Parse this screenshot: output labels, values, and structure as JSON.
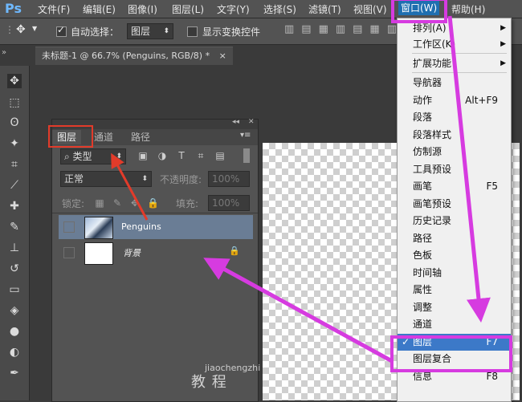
{
  "app": {
    "logo": "Ps"
  },
  "menubar": {
    "items": [
      "文件(F)",
      "编辑(E)",
      "图像(I)",
      "图层(L)",
      "文字(Y)",
      "选择(S)",
      "滤镜(T)",
      "视图(V)",
      "窗口(W)",
      "帮助(H)"
    ],
    "active": "窗口(W)"
  },
  "options": {
    "auto_select_label": "自动选择：",
    "auto_select_checked": true,
    "auto_select_target": "图层",
    "show_transform_label": "显示变换控件",
    "show_transform_checked": false
  },
  "document": {
    "tab_title": "未标题-1 @ 66.7% (Penguins, RGB/8) *",
    "close": "×"
  },
  "layers_panel": {
    "tabs": [
      "图层",
      "通道",
      "路径"
    ],
    "active_tab": "图层",
    "filter_kind": "类型",
    "blend_mode": "正常",
    "opacity_label": "不透明度:",
    "opacity_value": "100%",
    "lock_label": "锁定:",
    "fill_label": "填充:",
    "fill_value": "100%",
    "layers": [
      {
        "name": "Penguins",
        "selected": true
      },
      {
        "name": "背景",
        "locked": true
      }
    ]
  },
  "window_menu": {
    "items": [
      {
        "label": "排列(A)",
        "submenu": true
      },
      {
        "label": "工作区(K)",
        "submenu": true
      },
      {
        "label": "扩展功能",
        "submenu": true
      },
      {
        "label": "导航器"
      },
      {
        "label": "动作",
        "shortcut": "Alt+F9"
      },
      {
        "label": "段落"
      },
      {
        "label": "段落样式"
      },
      {
        "label": "仿制源"
      },
      {
        "label": "工具预设"
      },
      {
        "label": "画笔",
        "shortcut": "F5"
      },
      {
        "label": "画笔预设"
      },
      {
        "label": "历史记录"
      },
      {
        "label": "路径"
      },
      {
        "label": "色板"
      },
      {
        "label": "时间轴"
      },
      {
        "label": "属性"
      },
      {
        "label": "调整"
      },
      {
        "label": "通道"
      },
      {
        "label": "图层",
        "shortcut": "F7",
        "checked": true,
        "highlighted": true
      },
      {
        "label": "图层复合"
      },
      {
        "label": "信息",
        "shortcut": "F8"
      }
    ]
  },
  "watermark": {
    "text": "教 程",
    "sub": "jiaochengzhi"
  },
  "colors": {
    "annotation_magenta": "#d63be0",
    "annotation_red": "#e23b2a",
    "menu_highlight": "#3c79c8"
  }
}
